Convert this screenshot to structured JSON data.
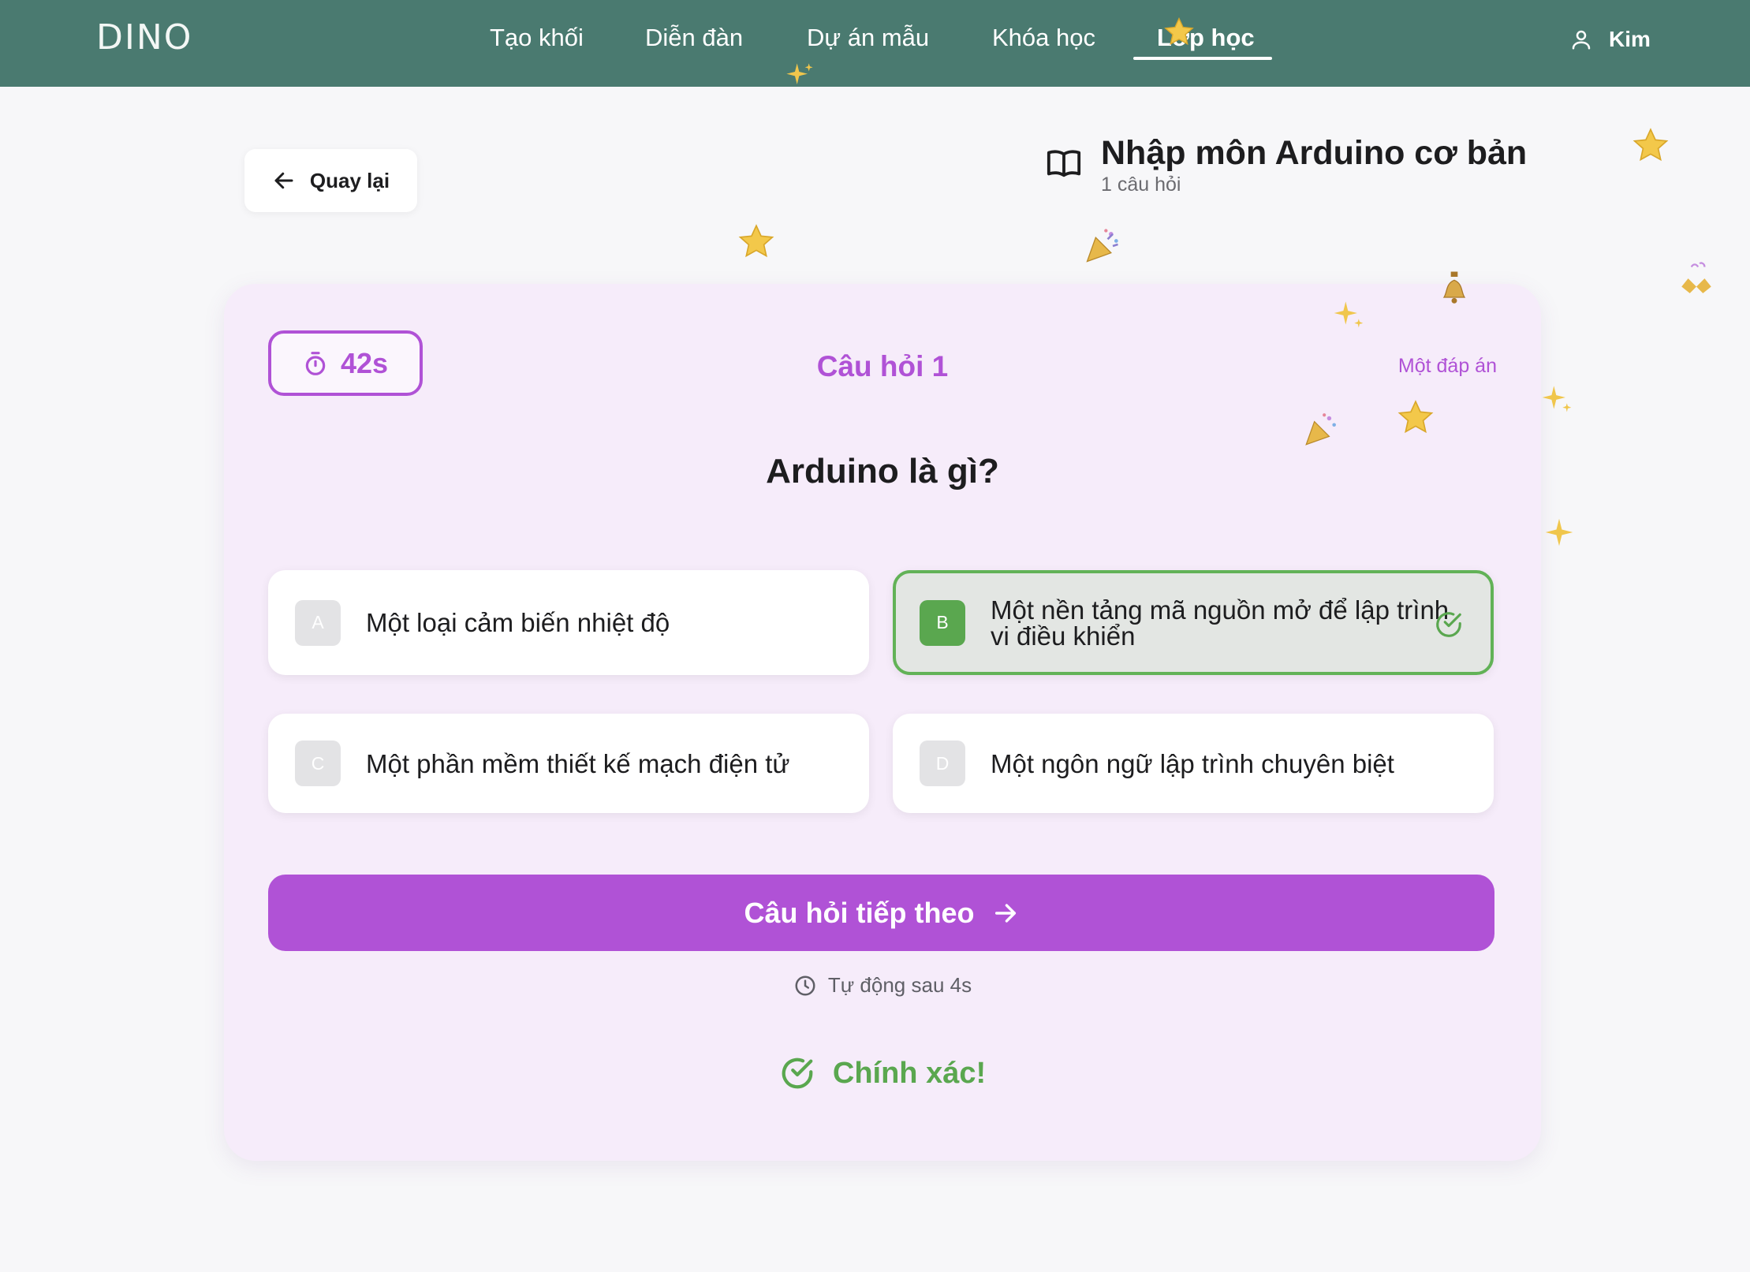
{
  "app": {
    "logo": "DINO"
  },
  "nav": {
    "items": [
      {
        "label": "Tạo khối"
      },
      {
        "label": "Diễn đàn"
      },
      {
        "label": "Dự án mẫu"
      },
      {
        "label": "Khóa học"
      },
      {
        "label": "Lớp học",
        "active": true
      }
    ],
    "user_name": "Kim"
  },
  "header": {
    "back_label": "Quay lại",
    "course_title": "Nhập môn Arduino cơ bản",
    "course_subtitle": "1 câu hỏi"
  },
  "quiz": {
    "timer": "42s",
    "question_number": "Câu hỏi 1",
    "question_type": "Một đáp án",
    "question": "Arduino là gì?",
    "options": [
      {
        "letter": "A",
        "text": "Một loại cảm biến nhiệt độ",
        "state": "default"
      },
      {
        "letter": "B",
        "text": "Một nền tảng mã nguồn mở để lập trình vi điều khiển",
        "state": "correct"
      },
      {
        "letter": "C",
        "text": "Một phần mềm thiết kế mạch điện tử",
        "state": "default"
      },
      {
        "letter": "D",
        "text": "Một ngôn ngữ lập trình chuyên biệt",
        "state": "default"
      }
    ],
    "next_label": "Câu hỏi tiếp theo",
    "auto_text": "Tự động sau 4s",
    "result_text": "Chính xác!"
  },
  "colors": {
    "nav_bg": "#4a7a70",
    "accent": "#b052d6",
    "correct": "#5aa74f",
    "card_bg": "#f6ecfa"
  },
  "icons": [
    "user-icon",
    "arrow-left-icon",
    "book-icon",
    "stopwatch-icon",
    "check-circle-icon",
    "arrow-right-icon",
    "clock-icon",
    "star-icon",
    "party-popper-icon",
    "sparkle-icon"
  ]
}
